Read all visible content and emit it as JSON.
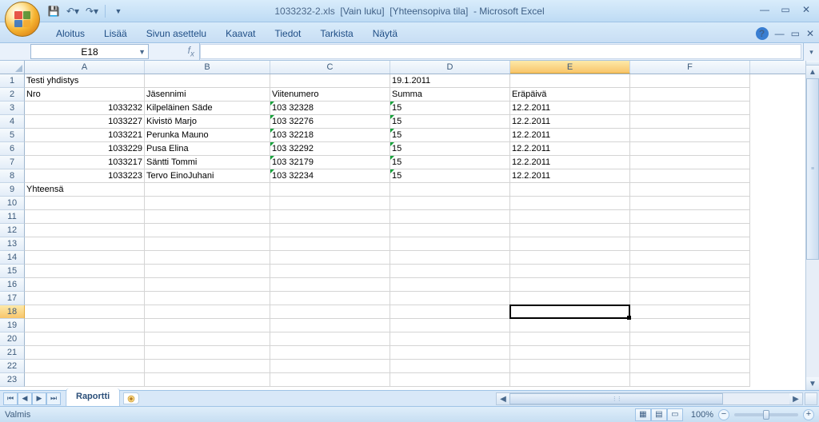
{
  "title": {
    "filename": "1033232-2.xls",
    "readonly": "[Vain luku]",
    "compat": "[Yhteensopiva tila]",
    "app": "- Microsoft Excel"
  },
  "qat": {
    "save_tip": "Save",
    "undo_tip": "Undo",
    "redo_tip": "Redo"
  },
  "ribbon_tabs": [
    "Aloitus",
    "Lisää",
    "Sivun asettelu",
    "Kaavat",
    "Tiedot",
    "Tarkista",
    "Näytä"
  ],
  "namebox": "E18",
  "columns": [
    {
      "letter": "A",
      "width": 150
    },
    {
      "letter": "B",
      "width": 157
    },
    {
      "letter": "C",
      "width": 150
    },
    {
      "letter": "D",
      "width": 150
    },
    {
      "letter": "E",
      "width": 150
    },
    {
      "letter": "F",
      "width": 150
    }
  ],
  "selected_col_index": 4,
  "selected_row": 18,
  "row_count": 23,
  "chart_data": {
    "type": "table",
    "title_row": {
      "A": "Testi yhdistys",
      "D": "19.1.2011"
    },
    "headers": {
      "A": "Nro",
      "B": "Jäsennimi",
      "C": "Viitenumero",
      "D": "Summa",
      "E": "Eräpäivä"
    },
    "rows": [
      {
        "nro": "1033232",
        "nimi": "Kilpeläinen Säde",
        "viite": "103 32328",
        "summa": "15",
        "era": "12.2.2011"
      },
      {
        "nro": "1033227",
        "nimi": "Kivistö Marjo",
        "viite": "103 32276",
        "summa": "15",
        "era": "12.2.2011"
      },
      {
        "nro": "1033221",
        "nimi": "Perunka Mauno",
        "viite": "103 32218",
        "summa": "15",
        "era": "12.2.2011"
      },
      {
        "nro": "1033229",
        "nimi": "Pusa Elina",
        "viite": "103 32292",
        "summa": "15",
        "era": "12.2.2011"
      },
      {
        "nro": "1033217",
        "nimi": "Säntti Tommi",
        "viite": "103 32179",
        "summa": "15",
        "era": "12.2.2011"
      },
      {
        "nro": "1033223",
        "nimi": "Tervo EinoJuhani",
        "viite": "103 32234",
        "summa": "15",
        "era": "12.2.2011"
      }
    ],
    "footer": {
      "A": "Yhteensä"
    }
  },
  "sheet_tab": "Raportti",
  "status_text": "Valmis",
  "zoom_pct": "100%"
}
